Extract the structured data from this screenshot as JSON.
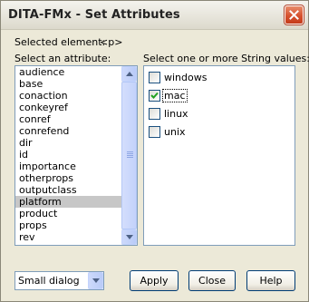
{
  "window": {
    "title": "DITA-FMx - Set Attributes"
  },
  "selected_element": {
    "label": "Selected element:",
    "value": "<p>"
  },
  "attributes": {
    "label": "Select an attribute:",
    "items": [
      "audience",
      "base",
      "conaction",
      "conkeyref",
      "conref",
      "conrefend",
      "dir",
      "id",
      "importance",
      "otherprops",
      "outputclass",
      "platform",
      "product",
      "props",
      "rev"
    ],
    "selected": "platform"
  },
  "values": {
    "label": "Select one or more String values:",
    "options": [
      {
        "label": "windows",
        "checked": false
      },
      {
        "label": "mac",
        "checked": true
      },
      {
        "label": "linux",
        "checked": false
      },
      {
        "label": "unix",
        "checked": false
      }
    ]
  },
  "dialog_size": {
    "selected": "Small dialog"
  },
  "buttons": {
    "apply": "Apply",
    "close": "Close",
    "help": "Help"
  },
  "colors": {
    "close_button": "#d6522f",
    "list_selection": "#c7c7c7",
    "focus_border": "#7f9db9",
    "button_border": "#003c74"
  },
  "icons": {
    "close": "close-x-icon",
    "check": "checkmark-icon",
    "scroll_up": "arrow-up-icon",
    "scroll_down": "arrow-down-icon",
    "dropdown": "chevron-down-icon"
  }
}
